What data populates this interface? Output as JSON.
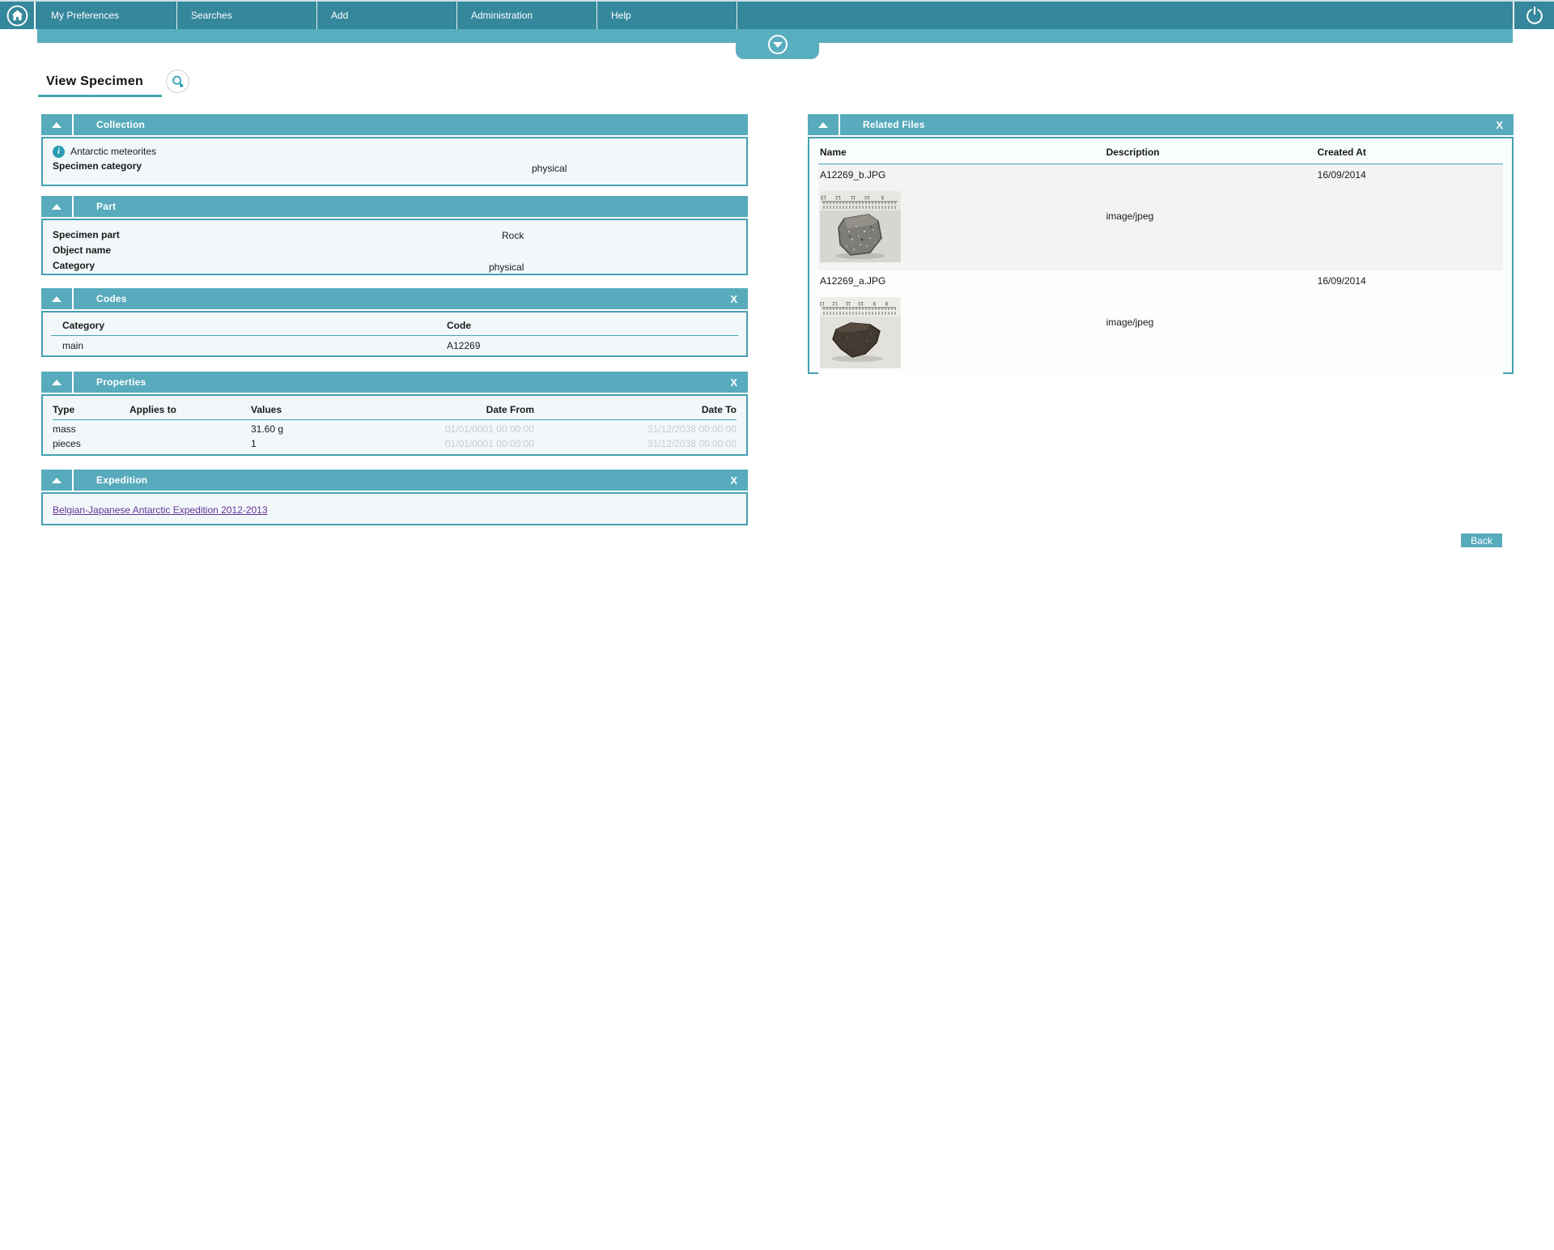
{
  "nav": {
    "items": [
      {
        "label": "My Preferences"
      },
      {
        "label": "Searches"
      },
      {
        "label": "Add"
      },
      {
        "label": "Administration"
      },
      {
        "label": "Help"
      }
    ]
  },
  "icons": {
    "home": "home-icon",
    "power": "power-icon",
    "preview": "magnifier-icon",
    "collapse": "chevron-up-icon",
    "expand": "chevron-down-icon",
    "info_glyph": "i",
    "close_glyph": "X"
  },
  "page": {
    "title": "View Specimen"
  },
  "panels": {
    "collection": {
      "title": "Collection",
      "info_text": "Antarctic meteorites",
      "fields": [
        {
          "label": "Specimen category",
          "value": "physical"
        }
      ]
    },
    "part": {
      "title": "Part",
      "fields": [
        {
          "label": "Specimen part",
          "value": "Rock"
        },
        {
          "label": "Object name",
          "value": ""
        },
        {
          "label": "Category",
          "value": "physical"
        }
      ]
    },
    "codes": {
      "title": "Codes",
      "columns": [
        "Category",
        "Code"
      ],
      "rows": [
        {
          "category": "main",
          "code": "A12269"
        }
      ]
    },
    "properties": {
      "title": "Properties",
      "columns": [
        "Type",
        "Applies to",
        "Values",
        "Date From",
        "Date To"
      ],
      "rows": [
        {
          "type": "mass",
          "applies_to": "",
          "values": "31.60 g",
          "date_from": "01/01/0001 00:00:00",
          "date_to": "31/12/2038 00:00:00"
        },
        {
          "type": "pieces",
          "applies_to": "",
          "values": "1",
          "date_from": "01/01/0001 00:00:00",
          "date_to": "31/12/2038 00:00:00"
        }
      ]
    },
    "expedition": {
      "title": "Expedition",
      "link_text": "Belgian-Japanese Antarctic Expedition 2012-2013"
    },
    "related_files": {
      "title": "Related Files",
      "columns": [
        "Name",
        "Description",
        "Created At"
      ],
      "rows": [
        {
          "name": "A12269_b.JPG",
          "description": "image/jpeg",
          "created_at": "16/09/2014"
        },
        {
          "name": "A12269_a.JPG",
          "description": "image/jpeg",
          "created_at": "16/09/2014"
        }
      ]
    }
  },
  "buttons": {
    "back": "Back"
  },
  "colors": {
    "nav_bar": "#35879b",
    "accent": "#57abbc",
    "panel_border": "#45a0b3",
    "panel_bg": "#f2f8fa",
    "link": "#663399",
    "muted_date": "#c8cdcf"
  }
}
